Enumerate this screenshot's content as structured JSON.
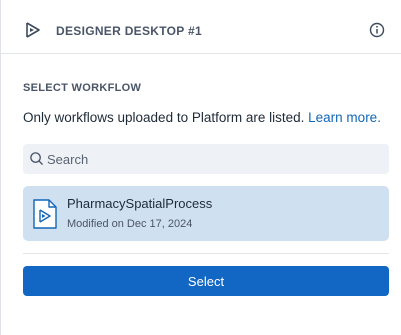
{
  "header": {
    "title": "DESIGNER DESKTOP #1",
    "logo_icon": "designer-logo-icon",
    "info_icon": "info-icon"
  },
  "section": {
    "label": "SELECT WORKFLOW",
    "description": "Only workflows uploaded to Platform are listed.",
    "learn_more": "Learn more."
  },
  "search": {
    "placeholder": "Search",
    "value": ""
  },
  "workflows": [
    {
      "name": "PharmacySpatialProcess",
      "modified": "Modified on Dec 17, 2024",
      "selected": true
    }
  ],
  "actions": {
    "select_label": "Select"
  },
  "colors": {
    "accent": "#1266c4",
    "link": "#1266b8",
    "selected_bg": "#cfe0f1",
    "search_bg": "#eef1f5"
  }
}
